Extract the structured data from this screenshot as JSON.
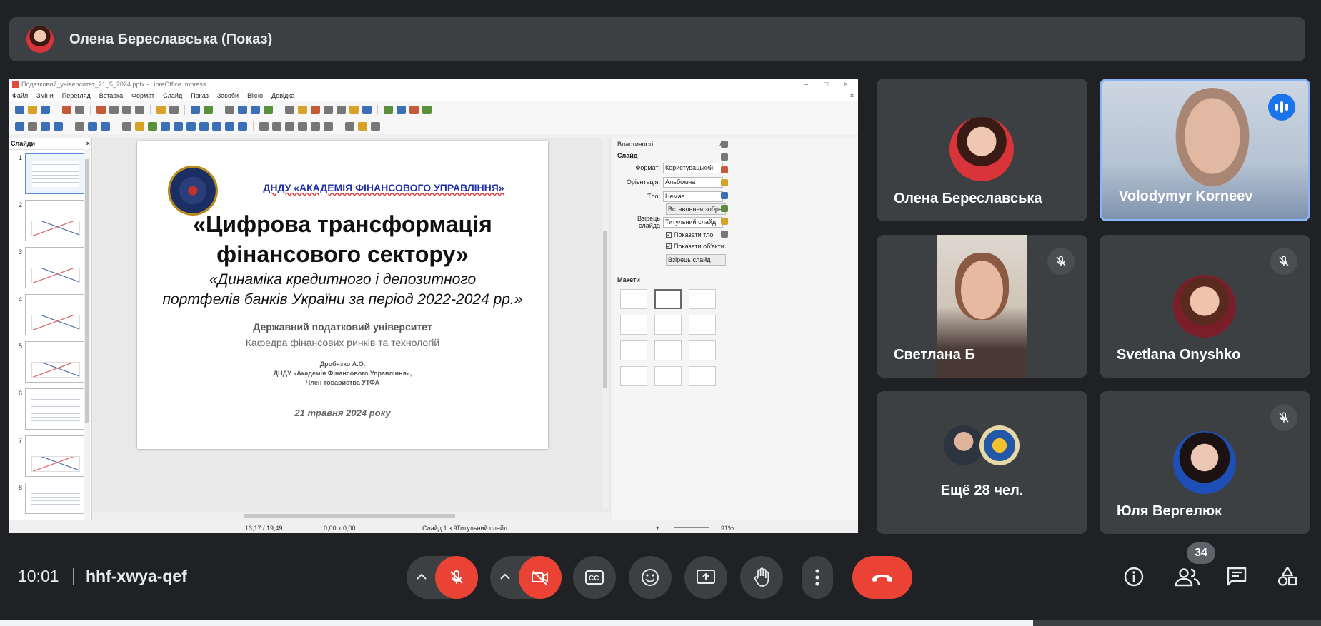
{
  "presenter": {
    "name": "Олена Береславська (Показ)"
  },
  "impress": {
    "window_title": "Податковий_університет_21_5_2024.pptx - LibreOffice Impress",
    "window_buttons": [
      "–",
      "□",
      "×"
    ],
    "menu": [
      "Файл",
      "Зміни",
      "Перегляд",
      "Вставка",
      "Формат",
      "Слайд",
      "Показ",
      "Засоби",
      "Вікно",
      "Довідка"
    ],
    "close_doc": "×",
    "slides_panel_title": "Слайди",
    "slides_panel_close": "×",
    "slide_numbers": [
      "1",
      "2",
      "3",
      "4",
      "5",
      "6",
      "7",
      "8"
    ],
    "slide": {
      "org": "ДНДУ «АКАДЕМІЯ ФІНАНСОВОГО УПРАВЛІННЯ»",
      "title_line1": "«Цифрова трансформація",
      "title_line2": "фінансового сектору»",
      "subtitle_line1": "«Динаміка кредитного і депозитного",
      "subtitle_line2": "портфелів банків України за період 2022-2024 рр.»",
      "university": "Державний податковий університет",
      "department": "Кафедра фінансових ринків та технологій",
      "author_name": "Дробязко А.О.",
      "author_org": "ДНДУ «Академія Фінансового Управління»,",
      "author_member": "Член товариства УТФА",
      "date": "21 травня 2024 року"
    },
    "properties": {
      "title": "Властивості",
      "close": "×",
      "section_slide": "Слайд",
      "format_label": "Формат:",
      "format_value": "Користувацький",
      "orientation_label": "Орієнтація:",
      "orientation_value": "Альбомна",
      "background_label": "Тло:",
      "background_value": "Немає",
      "insert_image": "Вставлення зображ",
      "master_label": "Взірець слайда",
      "master_value": "Титульний слайд",
      "show_background": "Показати тло",
      "show_objects": "Показати об'єкти",
      "master_button": "Взірець слайд",
      "section_layouts": "Макети"
    },
    "status": {
      "position": "13,17 / 19,49",
      "size": "0,00 x 0,00",
      "slide_counter": "Слайд 1 з 9",
      "master_name": "Титульний слайд",
      "zoom": "91%"
    }
  },
  "participants": [
    {
      "name": "Олена Береславська",
      "state": "avatar"
    },
    {
      "name": "Volodymyr Korneev",
      "state": "speaking"
    },
    {
      "name": "Светлана Б",
      "state": "muted"
    },
    {
      "name": "Svetlana Onyshko",
      "state": "muted"
    },
    {
      "name": "Ещё 28 чел.",
      "state": "group"
    },
    {
      "name": "Юля Вергелюк",
      "state": "muted"
    }
  ],
  "meeting": {
    "time": "10:01",
    "code": "hhf-xwya-qef",
    "participant_count": "34"
  },
  "colors": {
    "background": "#202124",
    "tile": "#3c4043",
    "danger": "#ea4335",
    "accent": "#1a73e8"
  }
}
